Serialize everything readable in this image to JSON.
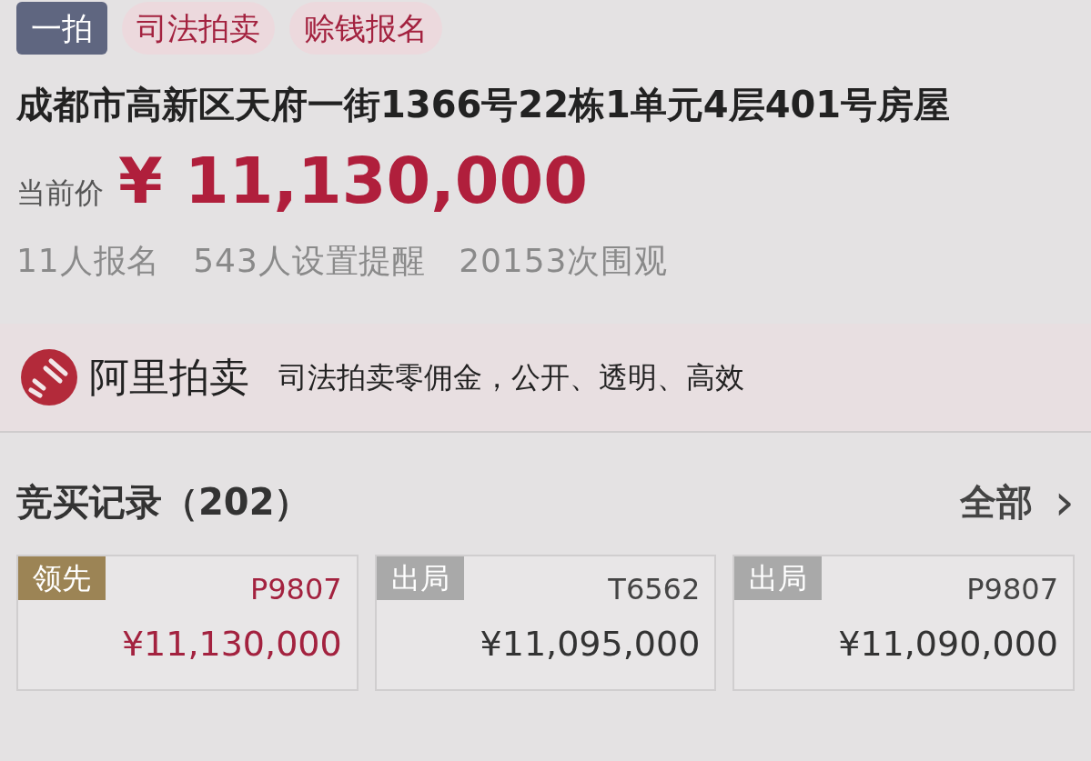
{
  "tags": [
    {
      "label": "一拍",
      "kind": "primary"
    },
    {
      "label": "司法拍卖",
      "kind": "soft"
    },
    {
      "label": "赊钱报名",
      "kind": "soft"
    }
  ],
  "title": "成都市高新区天府一街1366号22栋1单元4层401号房屋",
  "price": {
    "label": "当前价",
    "currency": "¥",
    "value": "11,130,000"
  },
  "stats": [
    "11人报名",
    "543人设置提醒",
    "20153次围观"
  ],
  "banner": {
    "brand": "阿里拍卖",
    "slogan": "司法拍卖零佣金，公开、透明、高效"
  },
  "bids_section": {
    "title": "竞买记录（202）",
    "more": "全部",
    "more_icon": "›",
    "bids": [
      {
        "status": "领先",
        "kind": "lead",
        "bidder": "P9807",
        "amount": "¥11,130,000"
      },
      {
        "status": "出局",
        "kind": "out",
        "bidder": "T6562",
        "amount": "¥11,095,000"
      },
      {
        "status": "出局",
        "kind": "out",
        "bidder": "P9807",
        "amount": "¥11,090,000"
      }
    ]
  }
}
